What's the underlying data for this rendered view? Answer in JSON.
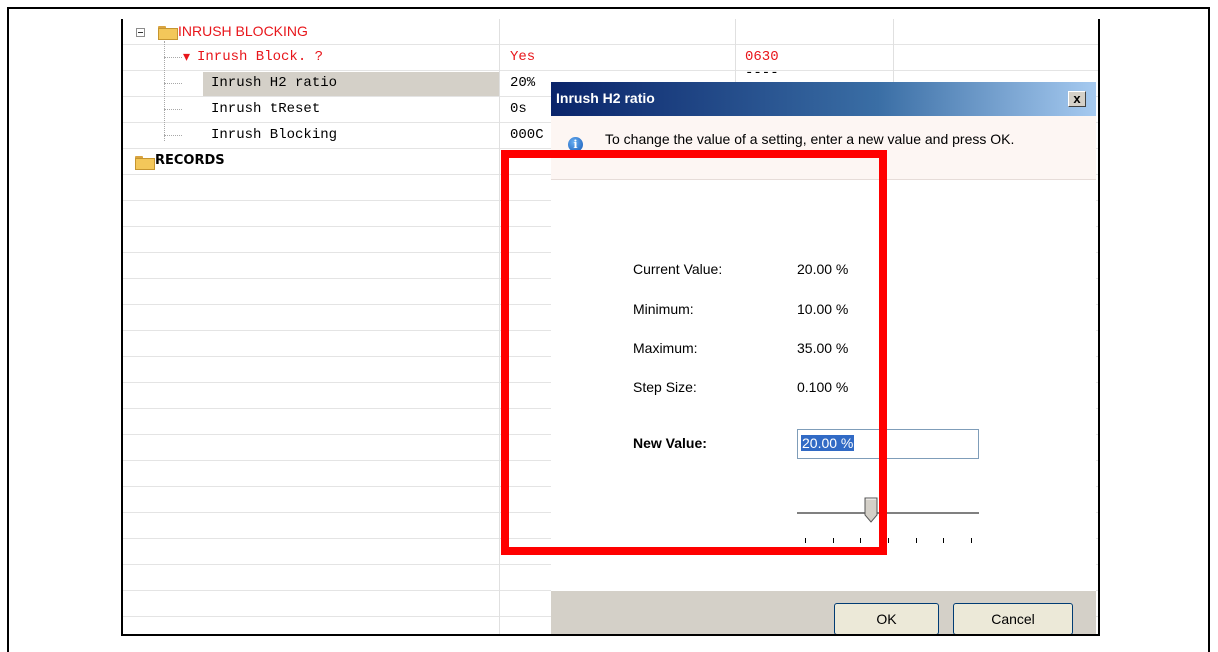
{
  "tree": {
    "rows": [
      {
        "label": "INRUSH BLOCKING",
        "value": "",
        "address": "",
        "kind": "folder-open",
        "color": "#e8161b"
      },
      {
        "label": "Inrush Block. ?",
        "value": "Yes",
        "address": "0630",
        "kind": "flag-setting",
        "color": "#e8161b"
      },
      {
        "label": "Inrush H2 ratio",
        "value": "20%",
        "address": "----",
        "kind": "setting-selected",
        "color": "#000000"
      },
      {
        "label": "Inrush tReset",
        "value": "0s",
        "address": "",
        "kind": "setting",
        "color": "#000000"
      },
      {
        "label": "Inrush Blocking",
        "value": "000C",
        "address": "",
        "kind": "setting",
        "color": "#000000"
      },
      {
        "label": "RECORDS",
        "value": "",
        "address": "",
        "kind": "folder",
        "color": "#000000"
      }
    ]
  },
  "dialog": {
    "title": "Inrush H2 ratio",
    "close_label": "x",
    "message": "To change the value of a setting, enter a new value and press OK.",
    "fields": {
      "current_label": "Current Value:",
      "current_value": "20.00 %",
      "min_label": "Minimum:",
      "min_value": "10.00 %",
      "max_label": "Maximum:",
      "max_value": "35.00 %",
      "step_label": "Step Size:",
      "step_value": "0.100 %",
      "new_label": "New Value:",
      "new_value": "20.00 %"
    },
    "slider": {
      "min": 10.0,
      "max": 35.0,
      "value": 20.0,
      "ticks": 7
    },
    "ok_label": "OK",
    "cancel_label": "Cancel"
  },
  "colors": {
    "highlight": "#ff0000",
    "titlebar_start": "#0a246a",
    "selection": "#316ac5"
  }
}
